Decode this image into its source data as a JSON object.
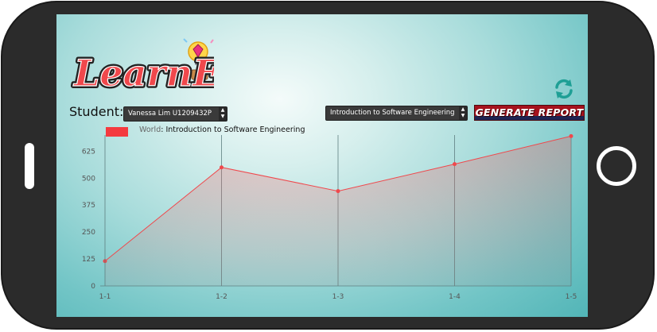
{
  "app": {
    "logo_text": "LearnEz"
  },
  "controls": {
    "student_label": "Student:",
    "student_value": "Vanessa Lim U1209432P",
    "module_value": "Introduction to Software Engineering",
    "generate_label": "GENERATE REPORT"
  },
  "legend": {
    "world": "World",
    "separator": ": ",
    "series_label": "Introduction to Software Engineering",
    "color": "#f43a3f"
  },
  "icons": {
    "refresh": "refresh-icon",
    "select_arrows": "chevron-up-down-icon",
    "logo_badge": "lightbulb-gem-icon"
  },
  "chart_data": {
    "type": "area",
    "categories": [
      "1-1",
      "1-2",
      "1-3",
      "1-4",
      "1-5"
    ],
    "series": [
      {
        "name": "Introduction to Software Engineering",
        "values": [
          115,
          550,
          440,
          565,
          695
        ]
      }
    ],
    "yticks": [
      0,
      125,
      250,
      375,
      500,
      625
    ],
    "ylim": [
      0,
      700
    ],
    "grid": "vertical",
    "legend_position": "top-left",
    "line_color": "#f0484c",
    "fill_color": "#f05a5e"
  }
}
